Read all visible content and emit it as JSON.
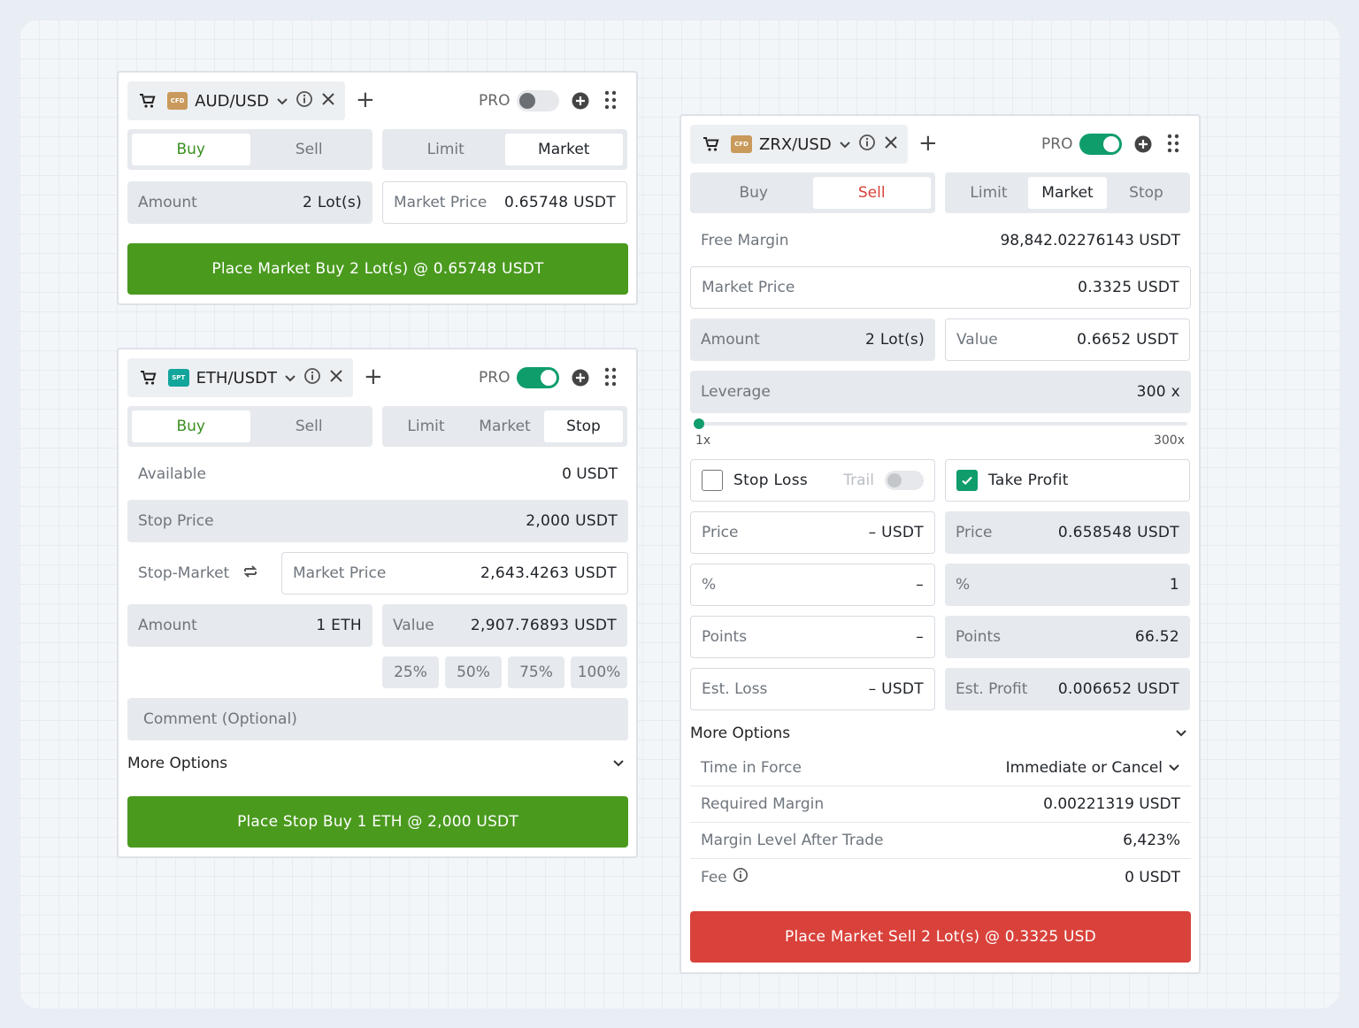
{
  "colors": {
    "accent_green": "#0f9d6b",
    "buy_green": "#4a9a1e",
    "sell_red": "#d9423b",
    "cfd_badge": "#c99a5b",
    "spot_badge": "#12a59b"
  },
  "panel1": {
    "badge": "CFD",
    "pair": "AUD/USD",
    "pro_label": "PRO",
    "pro_enabled": false,
    "side_tabs": [
      "Buy",
      "Sell"
    ],
    "active_side": "Buy",
    "order_tabs": [
      "Limit",
      "Market"
    ],
    "active_order": "Market",
    "amount": {
      "label": "Amount",
      "value": "2 Lot(s)"
    },
    "market_price": {
      "label": "Market Price",
      "value": "0.65748  USDT"
    },
    "submit": "Place Market Buy 2 Lot(s) @ 0.65748 USDT"
  },
  "panel2": {
    "badge": "SPT",
    "pair": "ETH/USDT",
    "pro_label": "PRO",
    "pro_enabled": true,
    "side_tabs": [
      "Buy",
      "Sell"
    ],
    "active_side": "Buy",
    "order_tabs": [
      "Limit",
      "Market",
      "Stop"
    ],
    "active_order": "Stop",
    "available": {
      "label": "Available",
      "value": "0 USDT"
    },
    "stop_price": {
      "label": "Stop Price",
      "value": "2,000  USDT"
    },
    "stop_type": "Stop-Market",
    "market_price": {
      "label": "Market Price",
      "value": "2,643.4263  USDT"
    },
    "amount": {
      "label": "Amount",
      "value": "1  ETH"
    },
    "value": {
      "label": "Value",
      "value": "2,907.76893  USDT"
    },
    "percent_buttons": [
      "25%",
      "50%",
      "75%",
      "100%"
    ],
    "comment_placeholder": "Comment (Optional)",
    "more_options": "More Options",
    "submit": "Place Stop Buy 1 ETH @ 2,000 USDT"
  },
  "panel3": {
    "badge": "CFD",
    "pair": "ZRX/USD",
    "pro_label": "PRO",
    "pro_enabled": true,
    "side_tabs": [
      "Buy",
      "Sell"
    ],
    "active_side": "Sell",
    "order_tabs": [
      "Limit",
      "Market",
      "Stop"
    ],
    "active_order": "Market",
    "free_margin": {
      "label": "Free Margin",
      "value": "98,842.02276143 USDT"
    },
    "market_price": {
      "label": "Market Price",
      "value": "0.3325  USDT"
    },
    "amount": {
      "label": "Amount",
      "value": "2 Lot(s)"
    },
    "value": {
      "label": "Value",
      "value": "0.6652  USDT"
    },
    "leverage": {
      "label": "Leverage",
      "value": "300  x"
    },
    "leverage_slider": {
      "min_label": "1x",
      "max_label": "300x",
      "level": 0.0
    },
    "stop_loss": {
      "label": "Stop Loss",
      "checked": false,
      "trail_label": "Trail",
      "price": {
        "label": "Price",
        "value": "–  USDT"
      },
      "percent": {
        "label": "%",
        "value": "–"
      },
      "points": {
        "label": "Points",
        "value": "–"
      },
      "est": {
        "label": "Est. Loss",
        "value": "–  USDT"
      }
    },
    "take_profit": {
      "label": "Take Profit",
      "checked": true,
      "price": {
        "label": "Price",
        "value": "0.658548  USDT"
      },
      "percent": {
        "label": "%",
        "value": "1"
      },
      "points": {
        "label": "Points",
        "value": "66.52"
      },
      "est": {
        "label": "Est. Profit",
        "value": "0.006652  USDT"
      }
    },
    "more_options": "More Options",
    "rows": [
      {
        "label": "Time in Force",
        "value": "Immediate or Cancel"
      },
      {
        "label": "Required Margin",
        "value": "0.00221319 USDT"
      },
      {
        "label": "Margin Level After Trade",
        "value": "6,423%"
      },
      {
        "label": "Fee",
        "value": "0 USDT"
      }
    ],
    "submit": "Place Market Sell 2 Lot(s) @ 0.3325 USD"
  }
}
